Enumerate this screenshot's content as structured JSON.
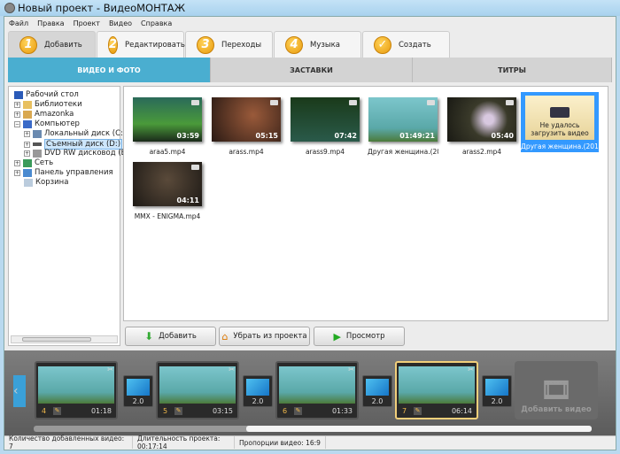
{
  "window": {
    "title": "Новый проект - ВидеоМОНТАЖ"
  },
  "menu": [
    "Файл",
    "Правка",
    "Проект",
    "Видео",
    "Справка"
  ],
  "steps": [
    {
      "num": "1",
      "label": "Добавить"
    },
    {
      "num": "2",
      "label": "Редактировать"
    },
    {
      "num": "3",
      "label": "Переходы"
    },
    {
      "num": "4",
      "label": "Музыка"
    },
    {
      "num": "✓",
      "label": "Создать"
    }
  ],
  "subtabs": [
    "ВИДЕО И ФОТО",
    "ЗАСТАВКИ",
    "ТИТРЫ"
  ],
  "tree": [
    {
      "label": "Рабочий стол"
    },
    {
      "label": "Библиотеки"
    },
    {
      "label": "Amazonka"
    },
    {
      "label": "Компьютер"
    },
    {
      "label": "Локальный диск (C:)"
    },
    {
      "label": "Съемный диск (D:)"
    },
    {
      "label": "DVD RW дисковод (E:)"
    },
    {
      "label": "Сеть"
    },
    {
      "label": "Панель управления"
    },
    {
      "label": "Корзина"
    }
  ],
  "files": [
    {
      "name": "araa5.mp4",
      "duration": "03:59",
      "color": "#3a7a3a"
    },
    {
      "name": "arass.mp4",
      "duration": "05:15",
      "color": "#5a3a2a"
    },
    {
      "name": "arass9.mp4",
      "duration": "07:42",
      "color": "#1e3a2a"
    },
    {
      "name": "Другая женщина.(2014)....",
      "duration": "01:49:21",
      "color": "#6ab4c4"
    },
    {
      "name": "arass2.mp4",
      "duration": "05:40",
      "color": "#2a2a22"
    },
    {
      "name": "Другая женщина.(2014...",
      "error": "Не удалось загрузить видео"
    },
    {
      "name": "MMX - ENIGMA.mp4",
      "duration": "04:11",
      "color": "#3a302a"
    }
  ],
  "actions": {
    "add": "Добавить",
    "remove": "Убрать из проекта",
    "preview": "Просмотр"
  },
  "timeline": {
    "clips": [
      {
        "num": "4",
        "time": "01:18"
      },
      {
        "num": "5",
        "time": "03:15"
      },
      {
        "num": "6",
        "time": "01:33"
      },
      {
        "num": "7",
        "time": "06:14"
      }
    ],
    "transitions": [
      "2.0",
      "2.0",
      "2.0",
      "2.0"
    ],
    "add_video": "Добавить видео"
  },
  "status": {
    "count": "Количество добавленных видео: 7",
    "duration": "Длительность проекта:  00:17:14",
    "ratio": "Пропорции видео:  16:9"
  }
}
